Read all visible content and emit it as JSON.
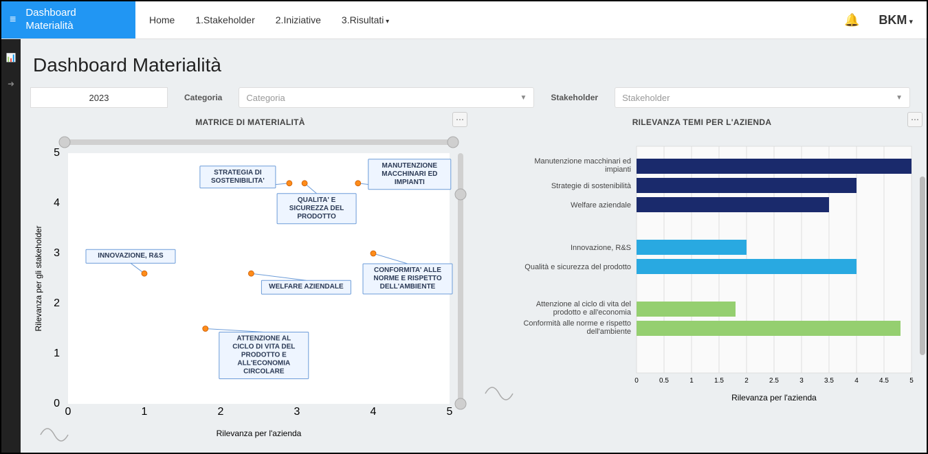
{
  "brand_title": "Dashboard\nMaterialità",
  "nav": {
    "home": "Home",
    "stake": "1.Stakeholder",
    "init": "2.Iniziative",
    "res": "3.Risultati"
  },
  "user": "BKM",
  "page_title": "Dashboard Materialità",
  "filters": {
    "year": "2023",
    "cat_label": "Categoria",
    "cat_ph": "Categoria",
    "sh_label": "Stakeholder",
    "sh_ph": "Stakeholder"
  },
  "scatter_title": "MATRICE DI MATERIALITÀ",
  "bar_title": "RILEVANZA TEMI PER L'AZIENDA",
  "chart_data": [
    {
      "type": "scatter",
      "title": "MATRICE DI MATERIALITÀ",
      "xlabel": "Rilevanza per l'azienda",
      "ylabel": "Rilevanza per gli stakeholder",
      "xlim": [
        0,
        5
      ],
      "ylim": [
        0,
        5
      ],
      "points": [
        {
          "label": "INNOVAZIONE, R&S",
          "x": 1.0,
          "y": 2.6
        },
        {
          "label": "ATTENZIONE AL CICLO DI VITA DEL PRODOTTO E ALL'ECONOMIA CIRCOLARE",
          "x": 1.8,
          "y": 1.5
        },
        {
          "label": "WELFARE AZIENDALE",
          "x": 2.4,
          "y": 2.6
        },
        {
          "label": "STRATEGIA DI SOSTENIBILITA'",
          "x": 2.9,
          "y": 4.4
        },
        {
          "label": "QUALITA' E SICUREZZA DEL PRODOTTO",
          "x": 3.1,
          "y": 4.4
        },
        {
          "label": "MANUTENZIONE MACCHINARI ED IMPIANTI",
          "x": 3.8,
          "y": 4.4
        },
        {
          "label": "CONFORMITA' ALLE NORME E RISPETTO DELL'AMBIENTE",
          "x": 4.0,
          "y": 3.0
        }
      ]
    },
    {
      "type": "bar",
      "orientation": "horizontal",
      "title": "RILEVANZA TEMI PER L'AZIENDA",
      "xlabel": "Rilevanza per l'azienda",
      "xlim": [
        0,
        5
      ],
      "xticks": [
        0,
        0.5,
        1.0,
        1.5,
        2.0,
        2.5,
        3.0,
        3.5,
        4.0,
        4.5,
        5.0
      ],
      "series": [
        {
          "group": "dark",
          "name": "Manutenzione macchinari ed impianti",
          "value": 5.0
        },
        {
          "group": "dark",
          "name": "Strategie di sostenibilità",
          "value": 4.0
        },
        {
          "group": "dark",
          "name": "Welfare aziendale",
          "value": 3.5
        },
        {
          "group": "blue",
          "name": "Innovazione, R&S",
          "value": 2.0
        },
        {
          "group": "blue",
          "name": "Qualità e sicurezza del prodotto",
          "value": 4.0
        },
        {
          "group": "green",
          "name": "Attenzione al ciclo di vita del prodotto e all'economia",
          "value": 1.8
        },
        {
          "group": "green",
          "name": "Conformità alle norme e rispetto dell'ambiente",
          "value": 4.8
        }
      ]
    }
  ]
}
